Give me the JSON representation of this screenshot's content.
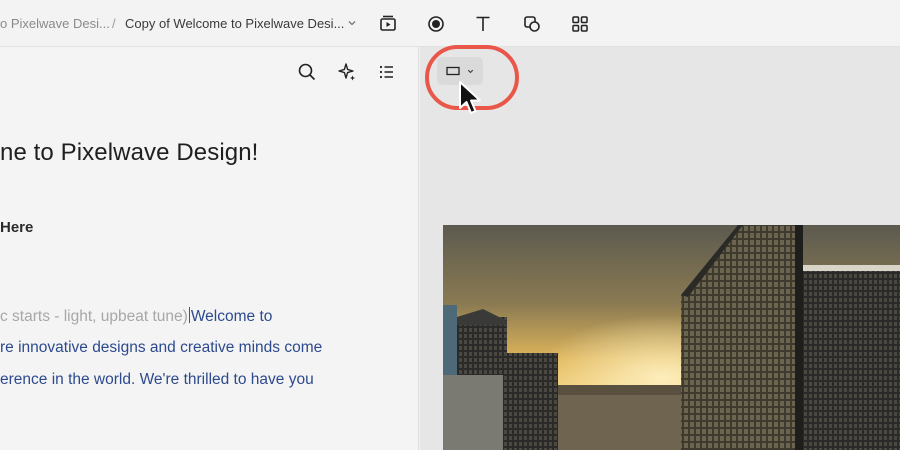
{
  "breadcrumb": {
    "parent": "o Pixelwave Desi...",
    "separator": "/",
    "current": "Copy of Welcome to Pixelwave Desi..."
  },
  "toolbar": {
    "tools": [
      "scene-icon",
      "record-icon",
      "text-icon",
      "shapes-icon",
      "grid-icon"
    ]
  },
  "panel_tools": [
    "search-icon",
    "sparkle-icon",
    "list-icon"
  ],
  "document": {
    "title": "ne to Pixelwave Design!",
    "heading": "Here",
    "line1_muted": "c starts - light, upbeat tune)",
    "line1_blue": "Welcome to",
    "line2": "re innovative designs and creative minds come",
    "line3": "erence in the world. We're thrilled to have you"
  },
  "colors": {
    "accent_ring": "#e9574a",
    "link_blue": "#2d4a8e",
    "muted_text": "#a7a7a7"
  }
}
